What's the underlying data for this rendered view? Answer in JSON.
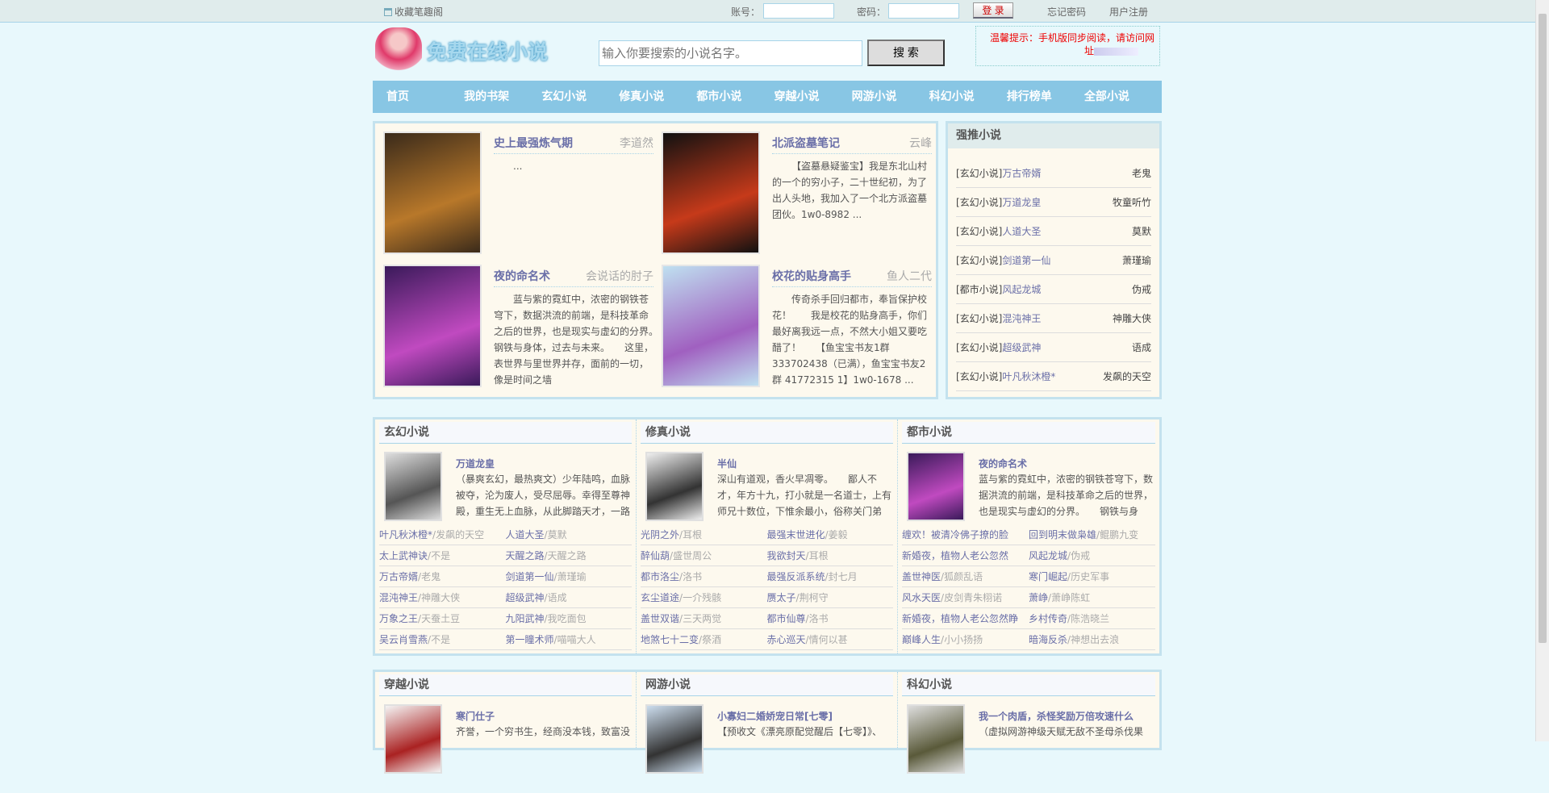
{
  "topbar": {
    "favorite": "收藏笔趣阁",
    "account_label": "账号：",
    "password_label": "密码：",
    "login": "登 录",
    "forgot": "忘记密码",
    "register": "用户注册"
  },
  "header": {
    "logo_text": "免费在线小说",
    "search_placeholder": "输入你要搜索的小说名字。",
    "search_button": "搜 索",
    "notice": "温馨提示：手机版同步阅读，请访问网",
    "notice_line2": "址"
  },
  "nav": [
    "首页",
    "我的书架",
    "玄幻小说",
    "修真小说",
    "都市小说",
    "穿越小说",
    "网游小说",
    "科幻小说",
    "排行榜单",
    "全部小说"
  ],
  "featured": [
    {
      "title": "史上最强炼气期",
      "author": "李道然",
      "desc": "...",
      "cover": [
        "#3a2a1a",
        "#b8782a"
      ]
    },
    {
      "title": "北派盗墓笔记",
      "author": "云峰",
      "desc": "【盗墓悬疑鉴宝】我是东北山村的一个的穷小子，二十世纪初，为了出人头地，我加入了一个北方派盗墓团伙。1w0-8982 ...",
      "cover": [
        "#111",
        "#c63a1a"
      ]
    },
    {
      "title": "夜的命名术",
      "author": "会说话的肘子",
      "desc": "蓝与紫的霓虹中，浓密的钢铁苍穹下，数据洪流的前端，是科技革命之后的世界，也是现实与虚幻的分界。　　钢铁与身体，过去与未来。　　这里，表世界与里世界并存，面前的一切，像是时间之墙",
      "cover": [
        "#3a1a5a",
        "#c04ac0"
      ]
    },
    {
      "title": "校花的贴身高手",
      "author": "鱼人二代",
      "desc": "传奇杀手回归都市，奉旨保护校花！　　我是校花的贴身高手，你们最好离我远一点，不然大小姐又要吃醋了！　　【鱼宝宝书友1群333702438（已满），鱼宝宝书友2群 41772315 1】1w0-1678 ...",
      "cover": [
        "#bfe0f0",
        "#a060c0"
      ]
    }
  ],
  "strong": {
    "title": "强推小说",
    "items": [
      {
        "cat": "[玄幻小说]",
        "name": "万古帝婿",
        "author": "老鬼"
      },
      {
        "cat": "[玄幻小说]",
        "name": "万道龙皇",
        "author": "牧童听竹"
      },
      {
        "cat": "[玄幻小说]",
        "name": "人道大圣",
        "author": "莫默"
      },
      {
        "cat": "[玄幻小说]",
        "name": "剑道第一仙",
        "author": "萧瑾瑜"
      },
      {
        "cat": "[都市小说]",
        "name": "风起龙城",
        "author": "伪戒"
      },
      {
        "cat": "[玄幻小说]",
        "name": "混沌神王",
        "author": "神雕大侠"
      },
      {
        "cat": "[玄幻小说]",
        "name": "超级武神",
        "author": "语成"
      },
      {
        "cat": "[玄幻小说]",
        "name": "叶凡秋沐橙*",
        "author": "发飙的天空"
      }
    ]
  },
  "categories": [
    {
      "title": "玄幻小说",
      "top": {
        "title": "万道龙皇",
        "desc": "（暴爽玄幻，最热爽文）少年陆鸣，血脉被夺，沦为废人，受尽屈辱。幸得至尊神殿，重生无上血脉，从此脚踏天才，一路"
      },
      "cover": [
        "#ddd",
        "#555"
      ],
      "list": [
        [
          "叶凡秋沐橙*",
          "发飙的天空"
        ],
        [
          "人道大圣",
          "莫默"
        ],
        [
          "太上武神诀",
          "不是"
        ],
        [
          "天醒之路",
          "天醒之路"
        ],
        [
          "万古帝婿",
          "老鬼"
        ],
        [
          "剑道第一仙",
          "萧瑾瑜"
        ],
        [
          "混沌神王",
          "神雕大侠"
        ],
        [
          "超级武神",
          "语成"
        ],
        [
          "万象之王",
          "天蚕土豆"
        ],
        [
          "九阳武神",
          "我吃面包"
        ],
        [
          "吴云肖雪燕",
          "不是"
        ],
        [
          "第一瞳术师",
          "喵喵大人"
        ]
      ]
    },
    {
      "title": "修真小说",
      "top": {
        "title": "半仙",
        "desc": "深山有道观，香火早凋零。　　鄙人不才，年方十九，打小就是一名道士，上有师兄十数位，下惟余最小，俗称关门弟"
      },
      "cover": [
        "#eee",
        "#333"
      ],
      "list": [
        [
          "光阴之外",
          "耳根"
        ],
        [
          "最强末世进化",
          "姜毅"
        ],
        [
          "醉仙葫",
          "盛世周公"
        ],
        [
          "我欲封天",
          "耳根"
        ],
        [
          "都市洛尘",
          "洛书"
        ],
        [
          "最强反派系统",
          "封七月"
        ],
        [
          "玄尘道途",
          "一介残骸"
        ],
        [
          "赝太子",
          "荆柯守"
        ],
        [
          "盖世双谐",
          "三天两觉"
        ],
        [
          "都市仙尊",
          "洛书"
        ],
        [
          "地煞七十二变",
          "祭酒"
        ],
        [
          "赤心巡天",
          "情何以甚"
        ]
      ]
    },
    {
      "title": "都市小说",
      "top": {
        "title": "夜的命名术",
        "desc": "蓝与紫的霓虹中，浓密的钢铁苍穹下，数据洪流的前端，是科技革命之后的世界，也是现实与虚幻的分界。　　钢铁与身"
      },
      "cover": [
        "#3a1a5a",
        "#c04ac0"
      ],
      "list": [
        [
          "缠欢！被清冷佛子撩的脸",
          ""
        ],
        [
          "回到明末做枭雄",
          "鲲鹏九变"
        ],
        [
          "新婚夜，植物人老公忽然",
          ""
        ],
        [
          "风起龙城",
          "伪戒"
        ],
        [
          "盖世神医",
          "狐颜乱语"
        ],
        [
          "寒门崛起",
          "历史军事"
        ],
        [
          "风水天医",
          "皮剑青朱栩诺"
        ],
        [
          "萧峥",
          "萧峥陈虹"
        ],
        [
          "新婚夜，植物人老公忽然睁",
          ""
        ],
        [
          "乡村传奇",
          "陈浩晓兰"
        ],
        [
          "巅峰人生",
          "小小扬扬"
        ],
        [
          "暗海反杀",
          "神想出去浪"
        ]
      ]
    },
    {
      "title": "穿越小说",
      "top": {
        "title": "寒门仕子",
        "desc": "齐誉，一个穷书生，经商没本钱，致富没"
      },
      "cover": [
        "#f4f4f4",
        "#a22"
      ],
      "list": []
    },
    {
      "title": "网游小说",
      "top": {
        "title": "小寡妇二婚娇宠日常[七零]",
        "desc": "【预收文《漂亮原配觉醒后【七零】》、"
      },
      "cover": [
        "#cde",
        "#333"
      ],
      "list": []
    },
    {
      "title": "科幻小说",
      "top": {
        "title": "我一个肉盾，杀怪奖励万倍攻速什么",
        "desc": "（虚拟网游神级天赋无敌不圣母杀伐果"
      },
      "cover": [
        "#ddd",
        "#5a5a3a"
      ],
      "list": []
    }
  ]
}
